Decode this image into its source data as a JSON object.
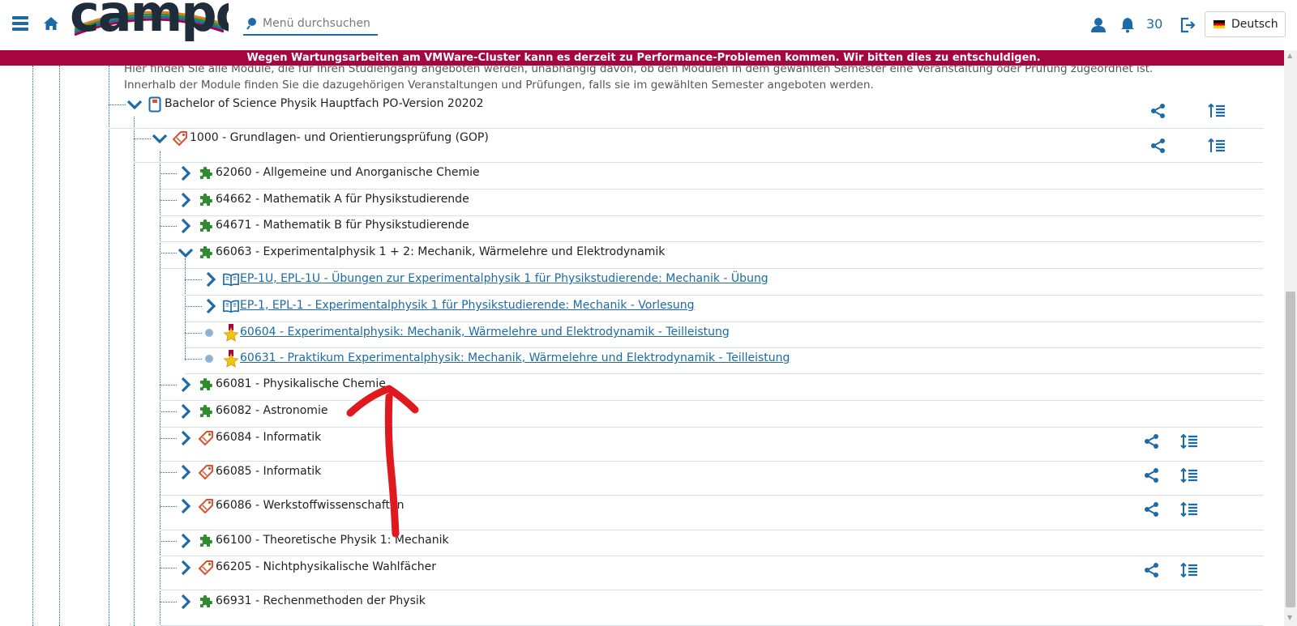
{
  "header": {
    "logo_text": "campo",
    "search_placeholder": "Menü durchsuchen",
    "session_timer": "30",
    "language": "Deutsch",
    "icons": [
      "menu-icon",
      "home-icon",
      "search-icon",
      "user-icon",
      "bell-icon",
      "logout-icon",
      "german-flag-icon"
    ]
  },
  "banner": {
    "text": "Wegen Wartungsarbeiten am VMWare-Cluster kann es derzeit zu Performance-Problemen kommen. Wir bitten dies zu entschuldigen.",
    "color": "#a5063f"
  },
  "intro": {
    "line1": "Hier finden Sie alle Module, die für Ihren Studiengang angeboten werden, unabhängig davon, ob den Modulen in dem gewählten Semester eine Veranstaltung oder Prüfung zugeordnet ist.",
    "line2": "Innerhalb der Module finden Sie die dazugehörigen Veranstaltungen und Prüfungen, falls sie im gewählten Semester angeboten werden."
  },
  "tree": [
    {
      "label": "Bachelor of Science Physik Hauptfach PO-Version 20202",
      "icon": "degree-program-icon",
      "expanded": true,
      "actions": true
    },
    {
      "label": "1000 - Grundlagen- und Orientierungsprüfung (GOP)",
      "icon": "tag-icon",
      "expanded": true,
      "actions": true
    },
    {
      "label": "62060 - Allgemeine und Anorganische Chemie",
      "icon": "puzzle-icon",
      "expanded": false
    },
    {
      "label": "64662 - Mathematik A für Physikstudierende",
      "icon": "puzzle-icon",
      "expanded": false
    },
    {
      "label": "64671 - Mathematik B für Physikstudierende",
      "icon": "puzzle-icon",
      "expanded": false
    },
    {
      "label": "66063 - Experimentalphysik 1 + 2: Mechanik, Wärmelehre und Elektrodynamik",
      "icon": "puzzle-icon",
      "expanded": true
    },
    {
      "label": "EP-1U, EPL-1U - Übungen zur Experimentalphysik 1 für Physikstudierende: Mechanik - Übung",
      "icon": "book-icon",
      "expanded": false
    },
    {
      "label": "EP-1, EPL-1 - Experimentalphysik 1 für Physikstudierende: Mechanik - Vorlesung",
      "icon": "book-icon",
      "expanded": false
    },
    {
      "label": "60604 - Experimentalphysik: Mechanik, Wärmelehre und Elektrodynamik - Teilleistung",
      "icon": "exam-star-icon"
    },
    {
      "label": "60631 - Praktikum Experimentalphysik: Mechanik, Wärmelehre und Elektrodynamik - Teilleistung",
      "icon": "exam-star-icon"
    },
    {
      "label": "66081 - Physikalische Chemie",
      "icon": "puzzle-icon",
      "expanded": false
    },
    {
      "label": "66082 - Astronomie",
      "icon": "puzzle-icon",
      "expanded": false
    },
    {
      "label": "66084 - Informatik",
      "icon": "tag-icon",
      "expanded": false,
      "actions": true
    },
    {
      "label": "66085 - Informatik",
      "icon": "tag-icon",
      "expanded": false,
      "actions": true
    },
    {
      "label": "66086 - Werkstoffwissenschaften",
      "icon": "tag-icon",
      "expanded": false,
      "actions": true
    },
    {
      "label": "66100 - Theoretische Physik 1: Mechanik",
      "icon": "puzzle-icon",
      "expanded": false
    },
    {
      "label": "66205 - Nichtphysikalische Wahlfächer",
      "icon": "tag-icon",
      "expanded": false,
      "actions": true
    },
    {
      "label": "66931 - Rechenmethoden der Physik",
      "icon": "puzzle-icon",
      "expanded": false
    }
  ],
  "colors": {
    "primary": "#1c6aa8",
    "module_green": "#2e8b2e",
    "tag_orange": "#d9532c",
    "annotation": "#e0191e"
  }
}
